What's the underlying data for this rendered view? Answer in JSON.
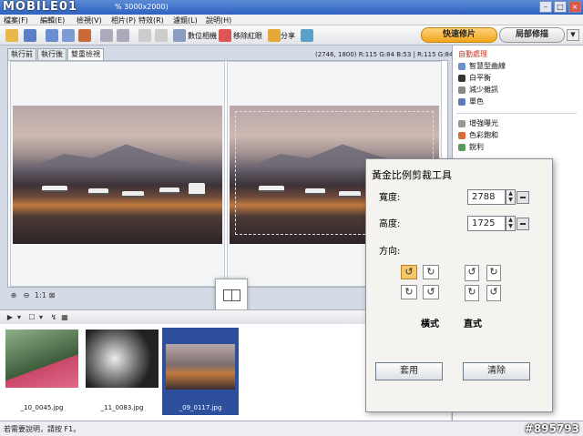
{
  "titlebar": {
    "logo": "MOBILE01",
    "title": "% 3000x2000)",
    "buttons": [
      "–",
      "□",
      "×"
    ]
  },
  "menu": {
    "items": [
      "檔案(F)",
      "編輯(E)",
      "檢視(V)",
      "相片(P)",
      "特效(R)",
      "濾鏡(L)",
      "說明(H)"
    ]
  },
  "toolbar": {
    "digital_photo_label": "數位相機",
    "redeye_label": "移除紅眼",
    "share_label": "分享",
    "quick_repair_label": "快速修片",
    "local_repair_label": "局部修描",
    "dropdown": "▼"
  },
  "view_tabs": [
    "執行前",
    "執行後",
    "雙重檢視"
  ],
  "image_info": "(2746, 1800) R:115 G:84 B:53 | R:115 G:84 B:53",
  "view_controls": [
    "⊕",
    "⊖",
    "1:1",
    "⊠"
  ],
  "filmstrip": {
    "controls": [
      "▶",
      "▾",
      "☐",
      "▾",
      "↯",
      "▦"
    ],
    "thumbs": [
      {
        "caption": "_10_0045.jpg"
      },
      {
        "caption": "_11_0083.jpg"
      },
      {
        "caption": "_09_0117.jpg"
      }
    ]
  },
  "status": {
    "text": "若需要說明，請按 F1。",
    "watermark": "#895793"
  },
  "right_panel": {
    "header": "自動處理",
    "items": [
      "智慧型曲線",
      "白平衡",
      "減少雜訊",
      "單色",
      "增強曝光",
      "色彩飽和",
      "銳利"
    ]
  },
  "dialog": {
    "title": "黃金比例剪裁工具",
    "width_label": "寬度:",
    "width_value": "2788",
    "height_label": "高度:",
    "height_value": "1725",
    "direction_label": "方向:",
    "landscape_label": "橫式",
    "portrait_label": "直式",
    "apply_label": "套用",
    "clear_label": "清除",
    "spin_up": "▲",
    "spin_down": "▼"
  },
  "colors": {
    "titlebar": "#2f62c0",
    "accent_orange": "#f0a51c",
    "selection_blue": "#2d4f9c"
  }
}
